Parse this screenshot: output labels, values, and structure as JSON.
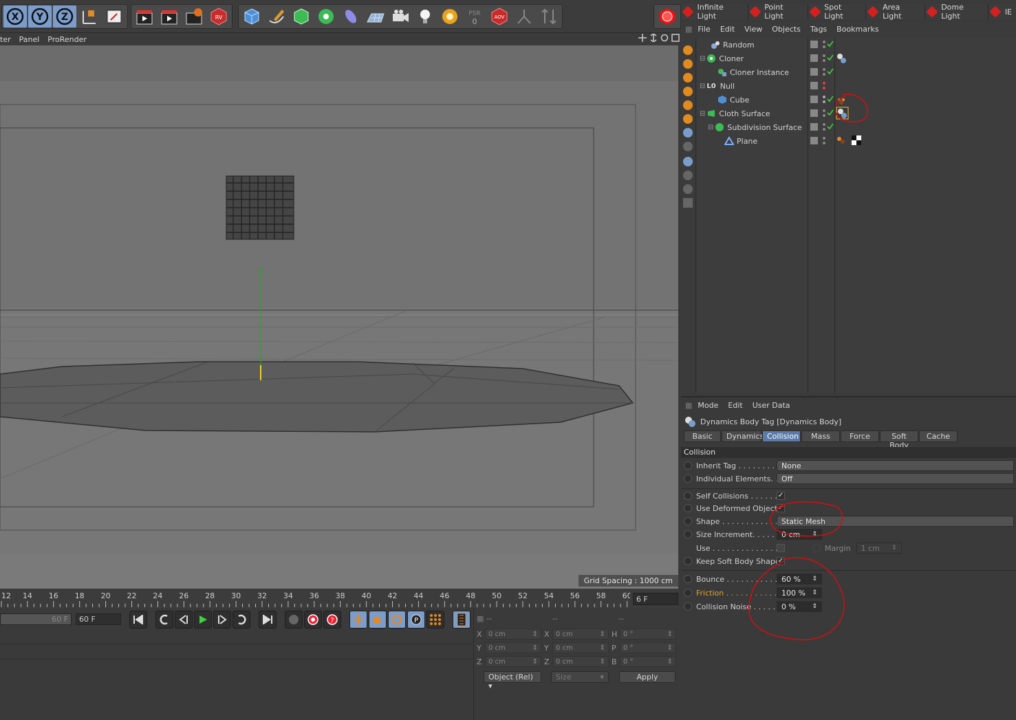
{
  "viewport": {
    "menu": [
      "ter",
      "Panel",
      "ProRender"
    ],
    "grid_spacing": "Grid Spacing : 1000 cm"
  },
  "timeline": {
    "ticks": [
      "12",
      "14",
      "16",
      "18",
      "20",
      "22",
      "24",
      "26",
      "28",
      "30",
      "32",
      "34",
      "36",
      "38",
      "40",
      "42",
      "44",
      "46",
      "48",
      "50",
      "52",
      "54",
      "56",
      "58",
      "60"
    ],
    "current_frame": "6 F",
    "end_frame_a": "60 F",
    "end_frame_b": "60 F"
  },
  "coordinates": {
    "rows": [
      {
        "a": "X",
        "av": "0 cm",
        "b": "X",
        "bv": "0 cm",
        "c": "H",
        "cv": "0 °"
      },
      {
        "a": "Y",
        "av": "0 cm",
        "b": "Y",
        "bv": "0 cm",
        "c": "P",
        "cv": "0 °"
      },
      {
        "a": "Z",
        "av": "0 cm",
        "b": "Z",
        "bv": "0 cm",
        "c": "B",
        "cv": "0 °"
      }
    ],
    "headers": [
      "--",
      "--",
      "--"
    ],
    "mode": "Object (Rel)",
    "size": "Size",
    "apply": "Apply"
  },
  "lights": [
    "Infinite Light",
    "Point Light",
    "Spot Light",
    "Area Light",
    "Dome Light",
    "IE"
  ],
  "object_manager": {
    "menu": [
      "File",
      "Edit",
      "View",
      "Objects",
      "Tags",
      "Bookmarks"
    ],
    "objects": [
      {
        "name": "Random",
        "indent": 1
      },
      {
        "name": "Cloner",
        "indent": 0
      },
      {
        "name": "Cloner Instance",
        "indent": 1
      },
      {
        "name": "Null",
        "indent": 0
      },
      {
        "name": "Cube",
        "indent": 1
      },
      {
        "name": "Cloth Surface",
        "indent": 0
      },
      {
        "name": "Subdivision Surface",
        "indent": 1
      },
      {
        "name": "Plane",
        "indent": 2
      }
    ]
  },
  "attributes": {
    "menu": [
      "Mode",
      "Edit",
      "User Data"
    ],
    "title": "Dynamics Body Tag [Dynamics Body]",
    "tabs": [
      "Basic",
      "Dynamics",
      "Collision",
      "Mass",
      "Force",
      "Soft Body",
      "Cache"
    ],
    "active_tab": "Collision",
    "section": "Collision",
    "inherit_tag_label": "Inherit Tag . . . . . . . . . .",
    "inherit_tag_value": "None",
    "individual_label": "Individual Elements. . .",
    "individual_value": "Off",
    "self_collisions_label": "Self Collisions . . . . . . .",
    "use_deformed_label": "Use Deformed Object",
    "shape_label": "Shape . . . . . . . . . . . . . .",
    "shape_value": "Static Mesh",
    "size_inc_label": "Size Increment. . . . . . .",
    "size_inc_value": "0 cm",
    "use_label": "Use . . . . . . . . . . . . . . . .",
    "margin_label": "Margin",
    "margin_value": "1 cm",
    "keep_soft_label": "Keep Soft Body Shape",
    "bounce_label": "Bounce . . . . . . . . . . . . .",
    "bounce_value": "60 %",
    "friction_label": "Friction . . . . . . . . . . . . .",
    "friction_value": "100 %",
    "noise_label": "Collision Noise . . . . . .",
    "noise_value": "0 %"
  },
  "colors": {
    "accent_blue": "#7b9dcb",
    "active_tab": "#5a7aa8",
    "annotation_red": "#cc1111",
    "friction_label": "#e0a030"
  }
}
